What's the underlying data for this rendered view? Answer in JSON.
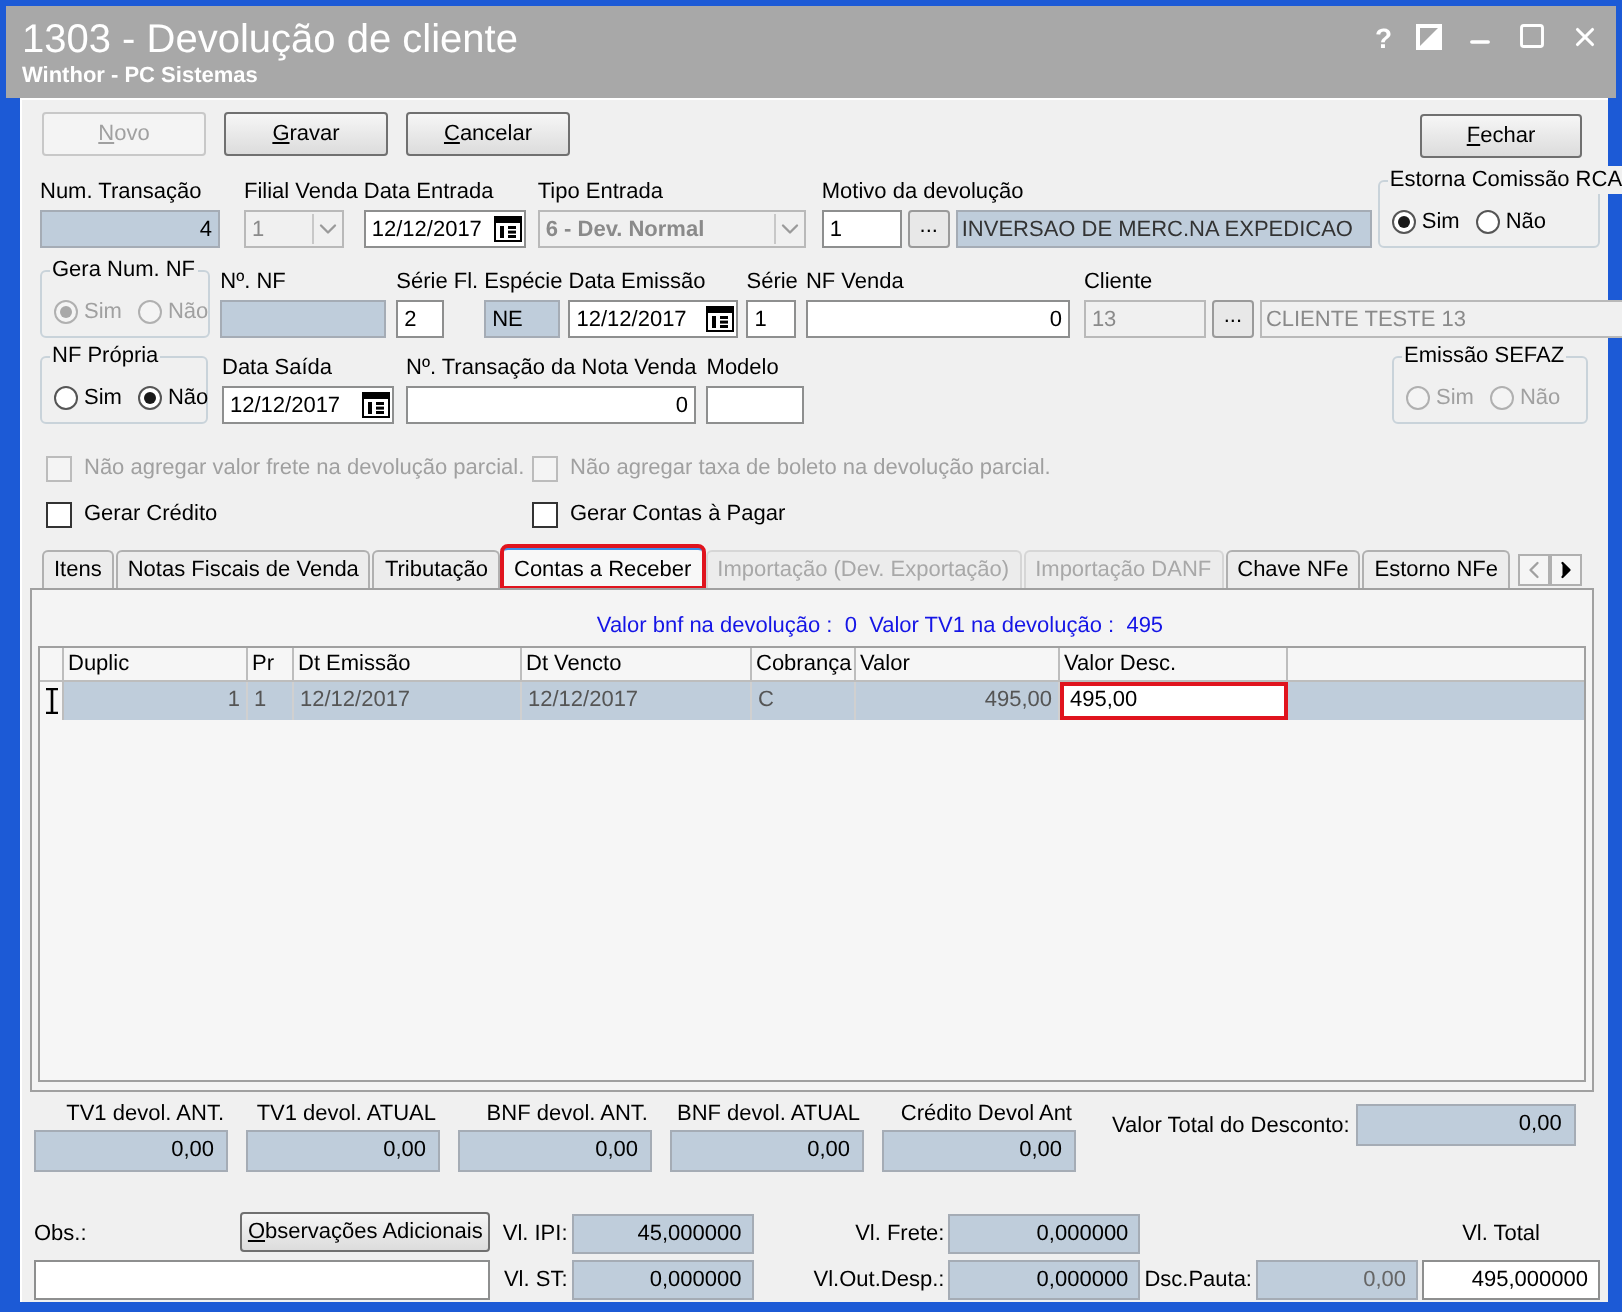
{
  "window": {
    "title": "1303 - Devolução de cliente",
    "subtitle": "Winthor - PC Sistemas",
    "help": "?"
  },
  "toolbar": {
    "buttons": [
      {
        "label": "Novo",
        "disabled": true
      },
      {
        "label": "Gravar",
        "disabled": false
      },
      {
        "label": "Cancelar",
        "disabled": false
      }
    ],
    "close_button": {
      "label": "Fechar",
      "disabled": false
    }
  },
  "row_1": {
    "fields": [
      {
        "label": "Num. Transação",
        "kind": "readonly",
        "value": "4"
      },
      {
        "label": "Filial Venda",
        "kind": "combo",
        "value": "1",
        "disabled": true,
        "bold": false
      },
      {
        "label": "Data Entrada",
        "kind": "date",
        "value": "12/12/2017"
      },
      {
        "label": "Tipo Entrada",
        "kind": "combo",
        "value": "6 - Dev. Normal",
        "disabled": true,
        "bold": true
      },
      {
        "label": "Motivo da devolução",
        "kind": "lookup",
        "value": "1",
        "button": "...",
        "description": "INVERSAO DE MERC.NA EXPEDICAO",
        "disabled": false
      }
    ],
    "group": {
      "title": "Estorna Comissão RCA",
      "disabled": false,
      "options": [
        {
          "label": "Sim",
          "selected": true
        },
        {
          "label": "Não",
          "selected": false
        }
      ]
    }
  },
  "row_2": {
    "group": {
      "title": "Gera Num. NF",
      "disabled": true,
      "options": [
        {
          "label": "Sim",
          "selected": true
        },
        {
          "label": "Não",
          "selected": false
        }
      ]
    },
    "fields": [
      {
        "label": "Nº. NF",
        "kind": "readonly"
      },
      {
        "label": "Série Fl.",
        "kind": "text",
        "value": "2"
      },
      {
        "label": "Espécie",
        "kind": "readonly",
        "value": "NE"
      },
      {
        "label": "Data Emissão",
        "kind": "date",
        "value": "12/12/2017"
      },
      {
        "label": "Série",
        "kind": "text",
        "value": "1"
      },
      {
        "label": "NF Venda",
        "kind": "text",
        "value": "0"
      },
      {
        "label": "Cliente",
        "kind": "lookup",
        "value": "13",
        "button": "...",
        "description": "CLIENTE TESTE 13",
        "disabled": true
      }
    ]
  },
  "row_3": {
    "group": {
      "title": "NF Própria",
      "disabled": false,
      "options": [
        {
          "label": "Sim",
          "selected": false
        },
        {
          "label": "Não",
          "selected": true
        }
      ]
    },
    "fields": [
      {
        "label": "Data Saída",
        "kind": "date",
        "value": "12/12/2017"
      },
      {
        "label": "Nº. Transação da Nota Venda",
        "kind": "text",
        "value": "0"
      },
      {
        "label": "Modelo",
        "kind": "text"
      }
    ],
    "right_group": {
      "title": "Emissão SEFAZ",
      "disabled": true,
      "options": [
        {
          "label": "Sim",
          "selected": false
        },
        {
          "label": "Não",
          "selected": false
        }
      ]
    }
  },
  "checkboxes": [
    {
      "label": "Não agregar valor frete na devolução parcial.",
      "checked": false,
      "disabled": true
    },
    {
      "label": "Não agregar taxa de boleto na devolução parcial.",
      "checked": false,
      "disabled": true
    },
    {
      "label": "Gerar Crédito",
      "checked": false,
      "disabled": false
    },
    {
      "label": "Gerar Contas à Pagar",
      "checked": false,
      "disabled": false
    }
  ],
  "tabs": [
    {
      "label": "Itens",
      "selected": false,
      "disabled": false,
      "highlighted": false
    },
    {
      "label": "Notas Fiscais de Venda",
      "selected": false,
      "disabled": false,
      "highlighted": false
    },
    {
      "label": "Tributação",
      "selected": false,
      "disabled": false,
      "highlighted": false
    },
    {
      "label": "Contas a Receber",
      "selected": true,
      "disabled": false,
      "highlighted": true
    },
    {
      "label": "Importação (Dev. Exportação)",
      "selected": false,
      "disabled": true,
      "highlighted": false
    },
    {
      "label": "Importação DANF",
      "selected": false,
      "disabled": true,
      "highlighted": false
    },
    {
      "label": "Chave NFe",
      "selected": false,
      "disabled": false,
      "highlighted": false
    },
    {
      "label": "Estorno NFe",
      "selected": false,
      "disabled": false,
      "highlighted": false
    }
  ],
  "info_line": "Valor bnf na devolução :  0  Valor TV1 na devolução :  495",
  "table": {
    "columns": [
      "Duplic",
      "Pr",
      "Dt Emissão",
      "Dt Vencto",
      "Cobrança",
      "Valor",
      "Valor Desc."
    ],
    "rows": [
      {
        "selected": true,
        "cells": [
          "1",
          "1",
          "12/12/2017",
          "12/12/2017",
          "C",
          "495,00"
        ],
        "edit_value": "495,00",
        "highlighted": true
      }
    ]
  },
  "totals": [
    {
      "label": "TV1 devol. ANT.",
      "value": "0,00"
    },
    {
      "label": "TV1 devol. ATUAL",
      "value": "0,00"
    },
    {
      "label": "BNF devol. ANT.",
      "value": "0,00"
    },
    {
      "label": "BNF devol. ATUAL",
      "value": "0,00"
    },
    {
      "label": "Crédito Devol Ant",
      "value": "0,00"
    }
  ],
  "total_discount": {
    "label": "Valor Total do Desconto:",
    "value": "0,00"
  },
  "obs": {
    "label": "Obs.:",
    "button": {
      "label": "Observações Adicionais"
    }
  },
  "values": [
    {
      "label": "Vl. IPI:",
      "value": "45,000000"
    },
    {
      "label": "Vl. Frete:",
      "value": "0,000000"
    },
    {
      "label": "Vl. ST:",
      "value": "0,000000"
    },
    {
      "label": "Vl.Out.Desp.:",
      "value": "0,000000"
    }
  ],
  "pauta": {
    "label": "Dsc.Pauta:",
    "value": "0,00"
  },
  "total": {
    "label": "Vl. Total",
    "value": "495,000000"
  }
}
